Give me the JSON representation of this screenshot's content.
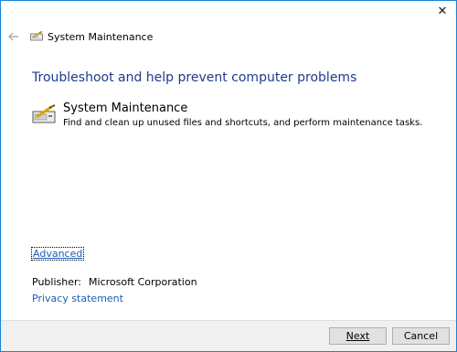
{
  "window": {
    "close_glyph": "✕",
    "back_icon": "back-arrow-icon"
  },
  "header": {
    "icon": "system-maintenance-icon",
    "title": "System Maintenance"
  },
  "main": {
    "heading": "Troubleshoot and help prevent computer problems",
    "item": {
      "icon": "system-maintenance-icon",
      "title": "System Maintenance",
      "description": "Find and clean up unused files and shortcuts, and perform maintenance tasks."
    },
    "advanced_link": "Advanced",
    "publisher_label": "Publisher:",
    "publisher_value": "Microsoft Corporation",
    "privacy_link": "Privacy statement"
  },
  "footer": {
    "next_label": "Next",
    "cancel_label": "Cancel"
  },
  "colors": {
    "border": "#1883d7",
    "heading": "#1e3a8e",
    "link": "#1e5cb3",
    "footer_bg": "#f0f0f0"
  }
}
